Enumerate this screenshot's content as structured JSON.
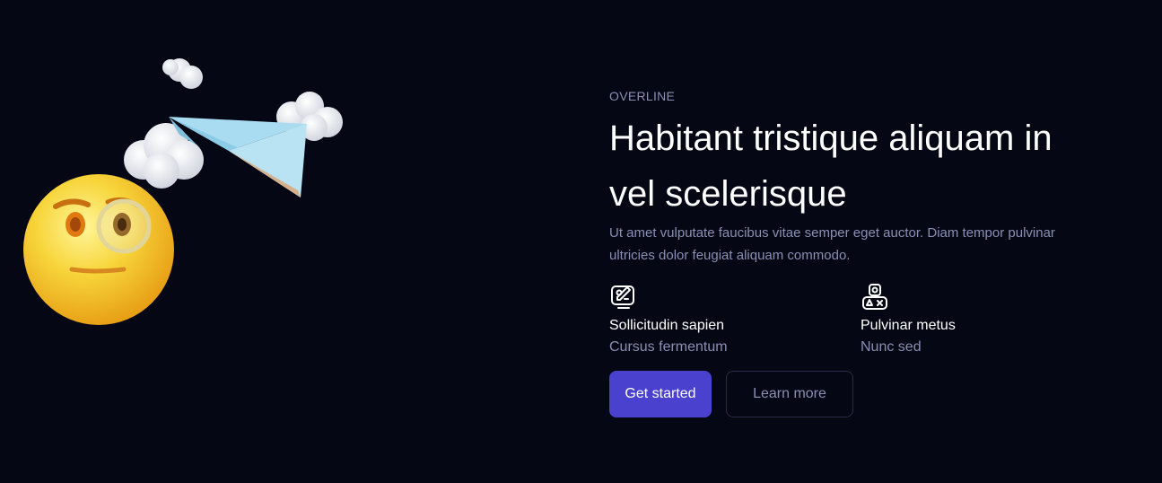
{
  "hero": {
    "overline": "OVERLINE",
    "title": "Habitant tristique aliquam in vel scelerisque",
    "description": "Ut amet vulputate faucibus vitae semper eget auctor. Diam tempor pulvinar ultricies dolor feugiat aliquam commodo."
  },
  "features": [
    {
      "icon": "edit-screen-icon",
      "title": "Sollicitudin sapien",
      "subtitle": "Cursus fermentum"
    },
    {
      "icon": "shapes-icon",
      "title": "Pulvinar metus",
      "subtitle": "Nunc sed"
    }
  ],
  "buttons": {
    "primary_label": "Get started",
    "secondary_label": "Learn more"
  },
  "colors": {
    "background": "#050714",
    "accent": "#4a41cf",
    "muted_text": "#8a8fb3"
  },
  "illustration": {
    "name": "suspicious-emoji-paper-plane-clouds"
  }
}
